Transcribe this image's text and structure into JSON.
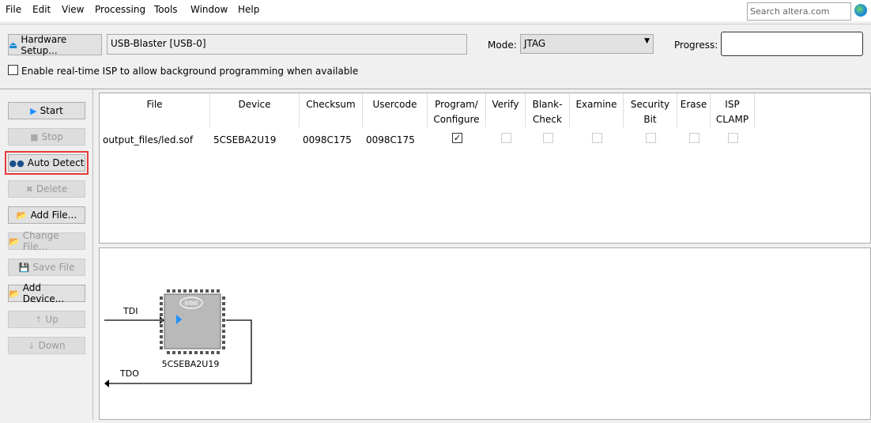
{
  "menu": [
    "File",
    "Edit",
    "View",
    "Processing",
    "Tools",
    "Window",
    "Help"
  ],
  "search": {
    "placeholder": "Search altera.com"
  },
  "toolbar": {
    "hardware_setup": "Hardware Setup...",
    "hardware_value": "USB-Blaster [USB-0]",
    "mode_label": "Mode:",
    "mode_value": "JTAG",
    "progress_label": "Progress:",
    "progress": 0,
    "isp_label": "Enable real-time ISP to allow background programming when available",
    "isp_checked": false
  },
  "buttons": [
    {
      "label": "Start",
      "enabled": true,
      "icon": "start-icon"
    },
    {
      "label": "Stop",
      "enabled": false,
      "icon": "stop-icon"
    },
    {
      "label": "Auto Detect",
      "enabled": true,
      "icon": "binoculars-icon",
      "highlighted": true
    },
    {
      "label": "Delete",
      "enabled": false,
      "icon": "delete-icon"
    },
    {
      "label": "Add File...",
      "enabled": true,
      "icon": "add-file-icon"
    },
    {
      "label": "Change File...",
      "enabled": false,
      "icon": "change-file-icon"
    },
    {
      "label": "Save File",
      "enabled": false,
      "icon": "save-icon"
    },
    {
      "label": "Add Device...",
      "enabled": true,
      "icon": "add-device-icon"
    },
    {
      "label": "Up",
      "enabled": false,
      "icon": "up-icon"
    },
    {
      "label": "Down",
      "enabled": false,
      "icon": "down-icon"
    }
  ],
  "table": {
    "headers": [
      [
        "File"
      ],
      [
        "Device"
      ],
      [
        "Checksum"
      ],
      [
        "Usercode"
      ],
      [
        "Program/",
        "Configure"
      ],
      [
        "Verify"
      ],
      [
        "Blank-",
        "Check"
      ],
      [
        "Examine"
      ],
      [
        "Security",
        "Bit"
      ],
      [
        "Erase"
      ],
      [
        "ISP",
        "CLAMP"
      ]
    ],
    "rows": [
      {
        "file": "output_files/led.sof",
        "device": "5CSEBA2U19",
        "checksum": "0098C175",
        "usercode": "0098C175",
        "program": true,
        "verify": false,
        "blank_check": false,
        "examine": false,
        "security": false,
        "erase": false,
        "isp_clamp": false
      }
    ]
  },
  "diagram": {
    "tdi": "TDI",
    "tdo": "TDO",
    "device": "5CSEBA2U19",
    "logo": "intel"
  },
  "colors": {
    "highlight": "#e53935",
    "chip": "#b9b9b9",
    "arrow": "#1e90ff"
  }
}
